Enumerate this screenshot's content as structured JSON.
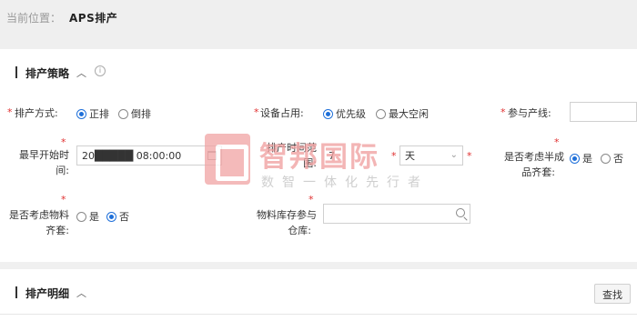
{
  "breadcrumb": {
    "label": "当前位置：",
    "current": "APS排产"
  },
  "section1": {
    "title": "排产策略",
    "chevron": "︿",
    "info": "i"
  },
  "form": {
    "required_mark": "*",
    "method": {
      "label": "排产方式:",
      "opt1": "正排",
      "opt2": "倒排"
    },
    "equipment": {
      "label": "设备占用:",
      "opt1": "优先级",
      "opt2": "最大空闲"
    },
    "line": {
      "label": "参与产线:"
    },
    "start_time": {
      "label_line1": "最早开始时",
      "label_line2": "间:",
      "value": "20█████ 08:00:00"
    },
    "range": {
      "label_line1": "排产时间范",
      "label_line2": "围:",
      "value": "7",
      "unit": "天"
    },
    "semi": {
      "label_line1": "是否考虑半成",
      "label_line2": "品齐套:",
      "opt1": "是",
      "opt2": "否"
    },
    "material": {
      "label_line1": "是否考虑物料",
      "label_line2": "齐套:",
      "opt1": "是",
      "opt2": "否"
    },
    "warehouse": {
      "label_line1": "物料库存参与",
      "label_line2": "仓库:"
    }
  },
  "section2": {
    "title": "排产明细",
    "chevron": "︿",
    "search_button": "查找"
  },
  "watermark": {
    "name": "智邦国际",
    "slogan": "数智一体化先行者"
  },
  "icons": [
    "chevron-up-icon",
    "info-icon",
    "calendar-icon",
    "chevron-down-icon",
    "search-icon"
  ],
  "colors": {
    "accent": "#1e6fd9",
    "required": "#e03030",
    "watermark": "#f1a3a3"
  }
}
